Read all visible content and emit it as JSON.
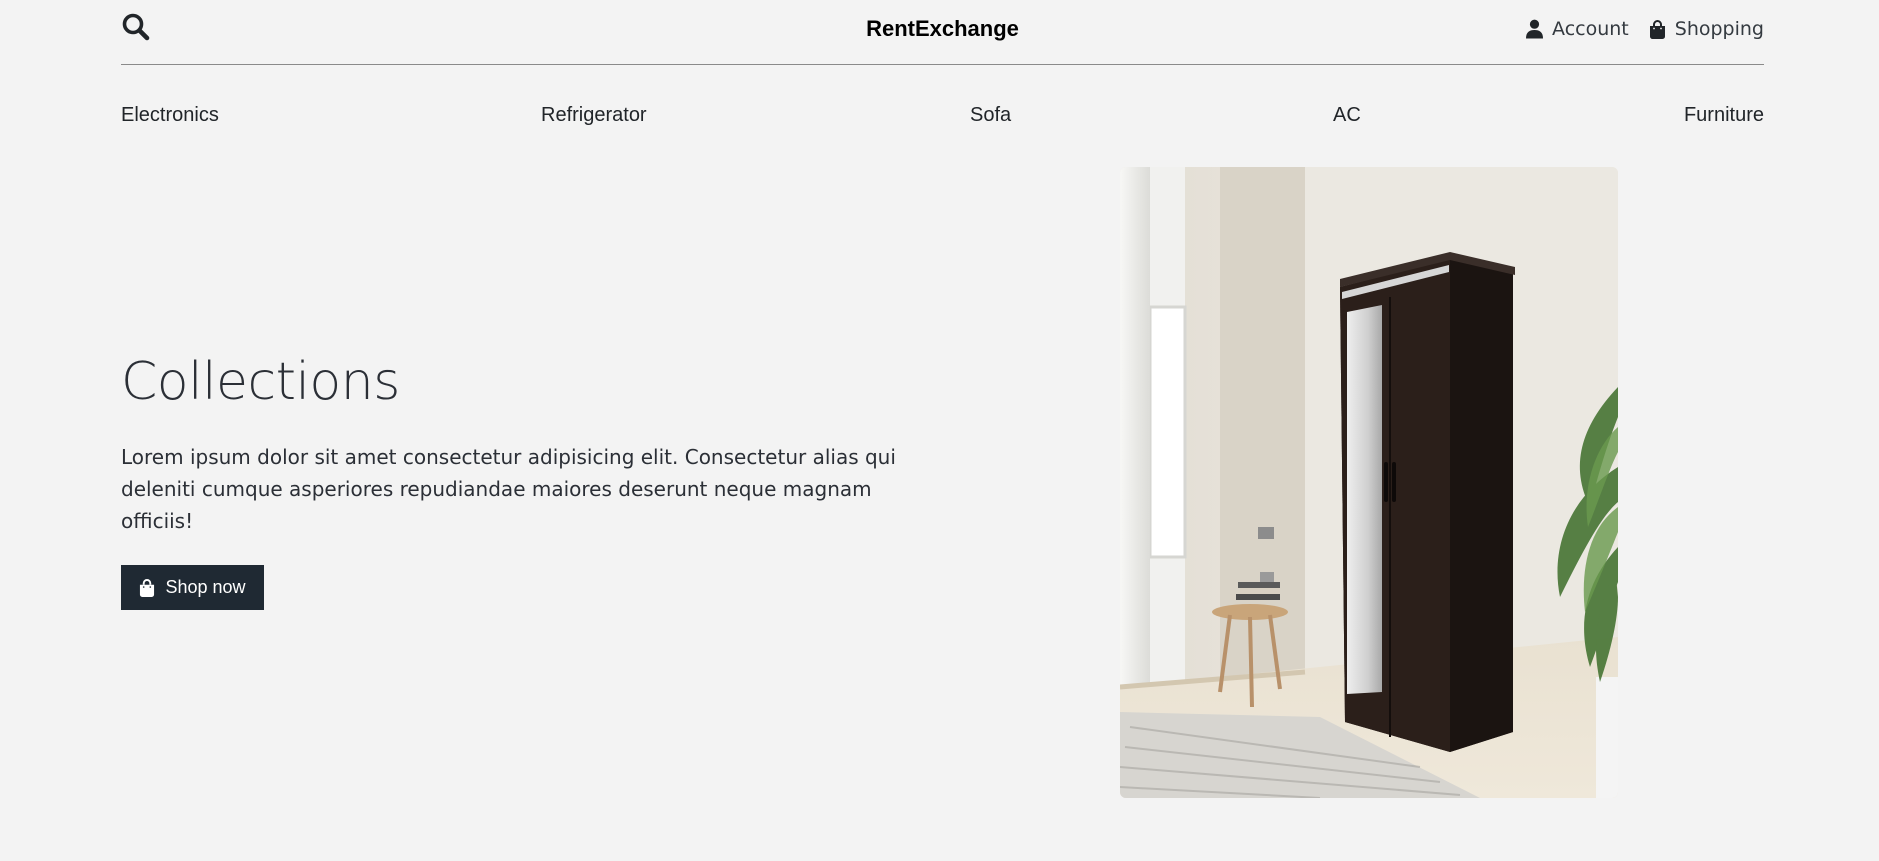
{
  "header": {
    "brand": "RentExchange",
    "account_label": "Account",
    "shopping_label": "Shopping"
  },
  "nav": {
    "items": [
      "Electronics",
      "Refrigerator",
      "Sofa",
      "AC",
      "Furniture"
    ]
  },
  "hero": {
    "title": "Collections",
    "text": "Lorem ipsum dolor sit amet consectetur adipisicing elit. Consectetur alias qui deleniti cumque asperiores repudiandae maiores deserunt neque magnam officiis!",
    "button_label": "Shop now",
    "image_alt": "wardrobe"
  },
  "icons": {
    "search": "search-icon",
    "account": "user-icon",
    "shopping": "shopping-bag-icon",
    "button": "shopping-bag-icon"
  },
  "colors": {
    "background": "#f3f3f3",
    "button": "#1f2933",
    "text": "#212529"
  }
}
